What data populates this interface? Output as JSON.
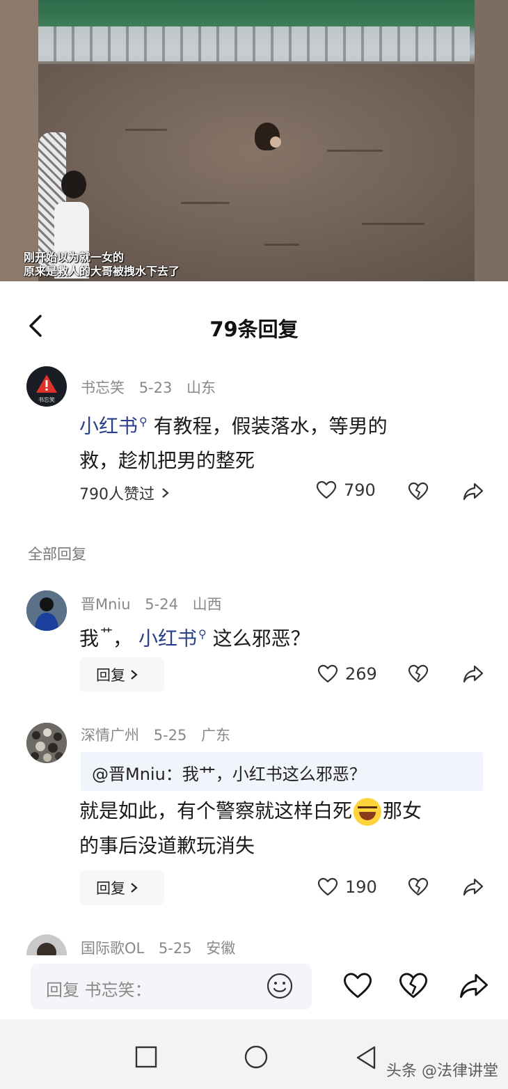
{
  "video": {
    "subtitle_line1": "刚开始以为就一女的",
    "subtitle_line2": "原来是救人的大哥被拽水下去了"
  },
  "header": {
    "title": "79条回复",
    "back_icon": "chevron-left-icon"
  },
  "main_comment": {
    "author": "书忘笑",
    "date": "5-23",
    "location": "山东",
    "avatar_text": "书忘笑",
    "link_text": "小红书",
    "text_after_link": "有教程，假装落水，等男的",
    "text_line2": "救，趁机把男的整死",
    "liked_by": "790人赞过",
    "likes": "790"
  },
  "section_label": "全部回复",
  "replies": [
    {
      "author": "晋Mniu",
      "date": "5-24",
      "location": "山西",
      "text_before": "我",
      "text_sup": "艹",
      "text_comma": "，",
      "link_text": "小红书",
      "text_after": "这么邪恶？",
      "reply_label": "回复",
      "likes": "269"
    },
    {
      "author": "深情广州",
      "date": "5-25",
      "location": "广东",
      "quote": "@晋Mniu：我艹，小红书这么邪恶？",
      "text_line1_a": "就是如此，有个警察就这样白死",
      "text_line1_b": "那女",
      "text_line2": "的事后没道歉玩消失",
      "reply_label": "回复",
      "likes": "190"
    },
    {
      "author": "国际歌OL",
      "date": "5-25",
      "location": "安徽"
    }
  ],
  "input": {
    "placeholder": "回复 书忘笑："
  },
  "watermark": "头条 @法律讲堂"
}
